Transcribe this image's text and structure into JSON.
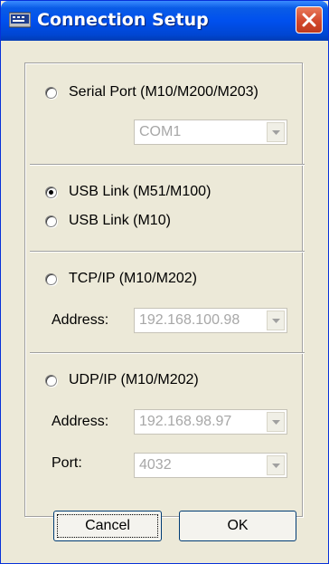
{
  "window": {
    "title": "Connection Setup"
  },
  "options": {
    "serial": {
      "label": "Serial Port (M10/M200/M203)",
      "port_value": "COM1"
    },
    "usb1": {
      "label": "USB Link (M51/M100)",
      "selected": true
    },
    "usb2": {
      "label": "USB Link (M10)"
    },
    "tcp": {
      "label": "TCP/IP (M10/M202)",
      "address_label": "Address:",
      "address_value": "192.168.100.98"
    },
    "udp": {
      "label": "UDP/IP (M10/M202)",
      "address_label": "Address:",
      "address_value": "192.168.98.97",
      "port_label": "Port:",
      "port_value": "4032"
    }
  },
  "buttons": {
    "cancel": "Cancel",
    "ok": "OK"
  },
  "colors": {
    "titlebar": "#0050ee",
    "face": "#ece9d8",
    "close": "#d2482c"
  }
}
